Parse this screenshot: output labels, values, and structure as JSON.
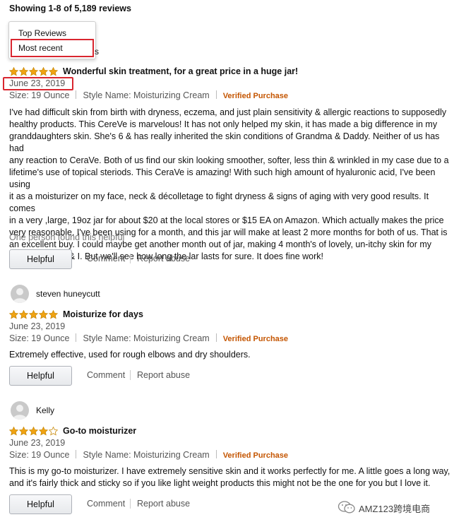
{
  "header": {
    "summary": "Showing 1-8 of 5,189 reviews"
  },
  "sort_dropdown": {
    "options": [
      "Top Reviews",
      "Most recent"
    ],
    "peek_text": "s"
  },
  "reviews": [
    {
      "stars": 5,
      "title": "Wonderful skin treatment, for a great price in a huge jar!",
      "date": "June 23, 2019",
      "size": "Size: 19 Ounce",
      "style": "Style Name: Moisturizing Cream",
      "verified": "Verified Purchase",
      "body_lines": [
        "I've had difficult skin from birth with dryness, eczema, and just plain sensitivity & allergic reactions to supposedly",
        "healthy products. This CereVe is marvelous! It has not only helped my skin, it has made a big difference in my",
        "granddaughters skin. She's 6 & has really inherited the skin conditions of Grandma & Daddy. Neither of us has had",
        "any reaction to CeraVe. Both of us find our skin looking smoother, softer, less thin & wrinkled in my case due to a",
        "lifetime's use of topical steriods. This CeraVe is amazing! With such high amount of hyaluronic acid, I've been using",
        "it as a moisturizer on my face, neck & décolletage to fight dryness & signs of aging with very good results. It comes",
        "in a very ,large, 19oz jar for about $20 at the local stores or $15 EA on Amazon. Which actually makes the price",
        "very reasonable. I've been using for a month, and this jar will make at least 2 more months for both of us. That is",
        "an excellent buy. I could maybe get another month out of jar, making 4 month's of lovely, un-itchy skin for my",
        "granddaughter & I. But we'll see how long the lar lasts for sure. It does fine work!"
      ],
      "helpful_count": "One person found this helpful",
      "helpful_label": "Helpful",
      "comment_label": "Comment",
      "report_label": "Report abuse"
    },
    {
      "author": "steven huneycutt",
      "stars": 5,
      "title": "Moisturize for days",
      "date": "June 23, 2019",
      "size": "Size: 19 Ounce",
      "style": "Style Name: Moisturizing Cream",
      "verified": "Verified Purchase",
      "body_lines": [
        "Extremely effective, used for rough elbows and dry shoulders."
      ],
      "helpful_label": "Helpful",
      "comment_label": "Comment",
      "report_label": "Report abuse"
    },
    {
      "author": "Kelly",
      "stars": 4,
      "title": "Go-to moisturizer",
      "date": "June 23, 2019",
      "size": "Size: 19 Ounce",
      "style": "Style Name: Moisturizing Cream",
      "verified": "Verified Purchase",
      "body_lines": [
        "This is my go-to moisturizer. I have extremely sensitive skin and it works perfectly for me. A little goes a long way,",
        "and it's fairly thick and sticky so if you like light weight products this might not be the one for you but I love it."
      ],
      "helpful_label": "Helpful",
      "comment_label": "Comment",
      "report_label": "Report abuse"
    }
  ],
  "watermark": {
    "text": "AMZ123跨境电商"
  },
  "colors": {
    "star_fill": "#f0a312",
    "star_empty": "#ffffff",
    "highlight_red": "#d9262f",
    "verified_orange": "#c45500"
  }
}
